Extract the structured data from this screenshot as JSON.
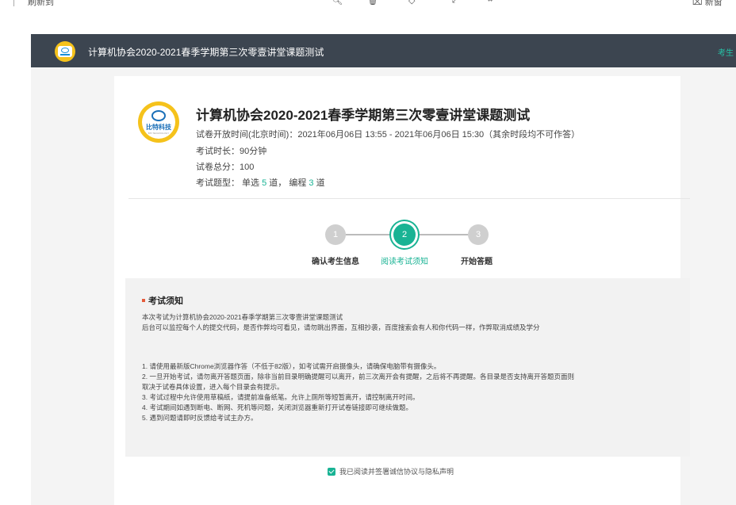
{
  "browser": {
    "left_label": "刷新到",
    "right_label": "新窗"
  },
  "topbar": {
    "title": "计算机协会2020-2021春季学期第三次零壹讲堂课题测试",
    "right_text": "考生"
  },
  "header": {
    "title": "计算机协会2020-2021春季学期第三次零壹讲堂课题测试",
    "logo_text": "比特科技",
    "logo_sub": "BIT-TECHNOLOGY",
    "open_time": "试卷开放时间(北京时间)：2021年06月06日 13:55 - 2021年06月06日 15:30（其余时段均不可作答）",
    "duration": "考试时长：90分钟",
    "total_score": "试卷总分：100",
    "types_prefix": "考试题型：  单选 ",
    "single_count": "5",
    "types_mid": " 道， 编程 ",
    "code_count": "3",
    "types_suffix": " 道"
  },
  "steps": [
    {
      "num": "1",
      "label": "确认考生信息",
      "state": "done"
    },
    {
      "num": "2",
      "label": "阅读考试须知",
      "state": "active"
    },
    {
      "num": "3",
      "label": "开始答题",
      "state": "pending"
    }
  ],
  "notice": {
    "title": "考试须知",
    "intro1": "本次考试为计算机协会2020-2021春季学期第三次零壹讲堂课题测试",
    "intro2": "后台可以监控每个人的提交代码，是否作弊均可看见，请勿跳出界面，互相抄袭，百度搜索会有人和你代码一样，作弊取消成绩及学分",
    "rule1": "1. 请使用最新版Chrome浏览器作答（不低于82版），如考试需开启摄像头，请确保电脑带有摄像头。",
    "rule2a": "2. 一旦开始考试，请勿离开答题页面，除非当前目录明确提醒可以离开，前三次离开会有提醒，之后将不再提醒。各目录是否支持离开答题页面则",
    "rule2b": "取决于试卷具体设置，进入每个目录会有提示。",
    "rule3": "3. 考试过程中允许使用草稿纸，请提前准备纸笔。允许上厕所等短暂离开，请控制离开时间。",
    "rule4": "4. 考试期间如遇到断电、断网、死机等问题，关闭浏览器重新打开试卷链接即可继续做题。",
    "rule5": "5. 遇到问题请即时反馈给考试主办方。"
  },
  "agree": {
    "label": "我已阅读并签署诚信协议与隐私声明",
    "checked": true
  },
  "colors": {
    "accent": "#19b394",
    "topbar": "#3c4550",
    "logo": "#f5c21b"
  }
}
